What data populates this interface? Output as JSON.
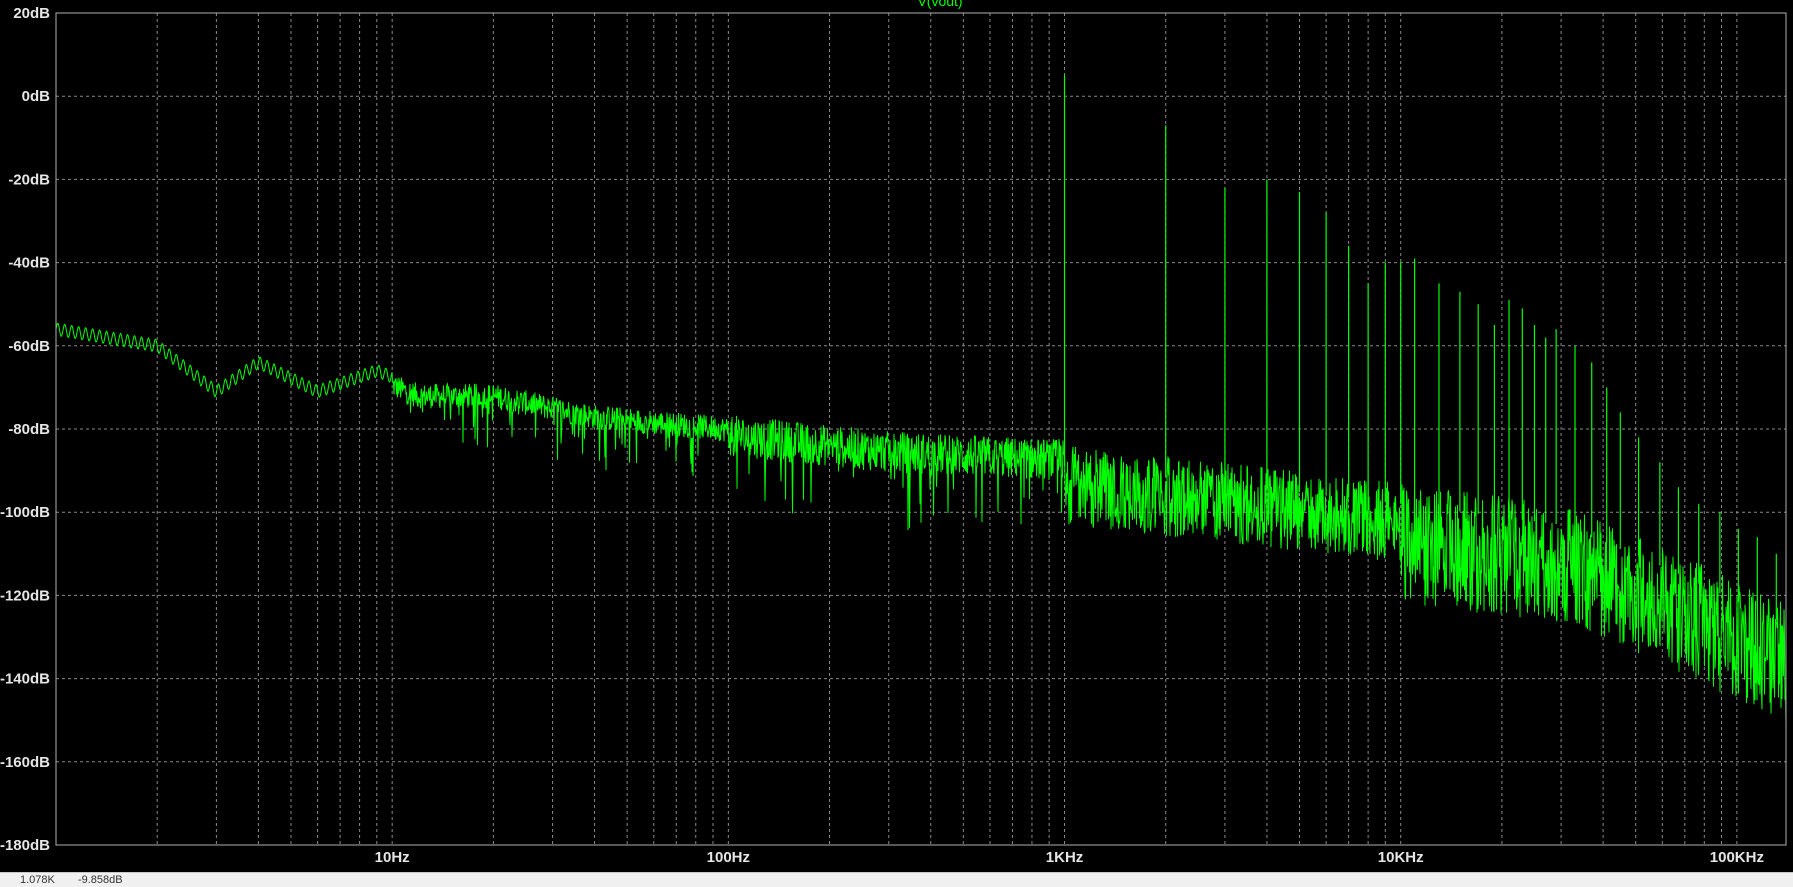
{
  "chart_data": {
    "type": "line",
    "title": "V(vout)",
    "xscale": "log",
    "xlim": [
      1,
      140000
    ],
    "ylim": [
      -180,
      20
    ],
    "grid": true,
    "x_ticks": [
      {
        "value": 10,
        "label": "10Hz"
      },
      {
        "value": 100,
        "label": "100Hz"
      },
      {
        "value": 1000,
        "label": "1KHz"
      },
      {
        "value": 10000,
        "label": "10KHz"
      },
      {
        "value": 100000,
        "label": "100KHz"
      }
    ],
    "y_ticks": [
      {
        "value": 20,
        "label": "20dB"
      },
      {
        "value": 0,
        "label": "0dB"
      },
      {
        "value": -20,
        "label": "-20dB"
      },
      {
        "value": -40,
        "label": "-40dB"
      },
      {
        "value": -60,
        "label": "-60dB"
      },
      {
        "value": -80,
        "label": "-80dB"
      },
      {
        "value": -100,
        "label": "-100dB"
      },
      {
        "value": -120,
        "label": "-120dB"
      },
      {
        "value": -140,
        "label": "-140dB"
      },
      {
        "value": -160,
        "label": "-160dB"
      },
      {
        "value": -180,
        "label": "-180dB"
      }
    ],
    "series": [
      {
        "name": "V(vout)",
        "color": "#00ff00",
        "envelope": [
          {
            "x": 1,
            "y": -56
          },
          {
            "x": 2,
            "y": -60
          },
          {
            "x": 3,
            "y": -71
          },
          {
            "x": 4,
            "y": -64
          },
          {
            "x": 6,
            "y": -71
          },
          {
            "x": 9,
            "y": -66
          },
          {
            "x": 12,
            "y": -70
          },
          {
            "x": 20,
            "y": -70
          },
          {
            "x": 40,
            "y": -75
          },
          {
            "x": 100,
            "y": -78
          },
          {
            "x": 300,
            "y": -82
          },
          {
            "x": 1000,
            "y": -84
          },
          {
            "x": 3000,
            "y": -88
          },
          {
            "x": 10000,
            "y": -93
          },
          {
            "x": 30000,
            "y": -98
          },
          {
            "x": 60000,
            "y": -108
          },
          {
            "x": 140000,
            "y": -122
          }
        ],
        "harmonics": [
          {
            "x": 1000,
            "y": 5
          },
          {
            "x": 2000,
            "y": -7
          },
          {
            "x": 3000,
            "y": -22
          },
          {
            "x": 4000,
            "y": -20
          },
          {
            "x": 5000,
            "y": -23
          },
          {
            "x": 6000,
            "y": -28
          },
          {
            "x": 7000,
            "y": -36
          },
          {
            "x": 8000,
            "y": -45
          },
          {
            "x": 9000,
            "y": -40
          },
          {
            "x": 10000,
            "y": -40
          },
          {
            "x": 11000,
            "y": -39
          },
          {
            "x": 13000,
            "y": -45
          },
          {
            "x": 15000,
            "y": -47
          },
          {
            "x": 17000,
            "y": -50
          },
          {
            "x": 19000,
            "y": -55
          },
          {
            "x": 21000,
            "y": -49
          },
          {
            "x": 23000,
            "y": -51
          },
          {
            "x": 25000,
            "y": -55
          },
          {
            "x": 27000,
            "y": -58
          },
          {
            "x": 29000,
            "y": -56
          },
          {
            "x": 33000,
            "y": -60
          },
          {
            "x": 37000,
            "y": -64
          },
          {
            "x": 41000,
            "y": -70
          },
          {
            "x": 45000,
            "y": -76
          },
          {
            "x": 51000,
            "y": -82
          },
          {
            "x": 59000,
            "y": -88
          },
          {
            "x": 67000,
            "y": -94
          },
          {
            "x": 77000,
            "y": -98
          },
          {
            "x": 89000,
            "y": -100
          },
          {
            "x": 101000,
            "y": -104
          },
          {
            "x": 115000,
            "y": -106
          },
          {
            "x": 131000,
            "y": -110
          }
        ]
      }
    ]
  },
  "status": {
    "left": "1.078K",
    "right": "-9.858dB"
  }
}
